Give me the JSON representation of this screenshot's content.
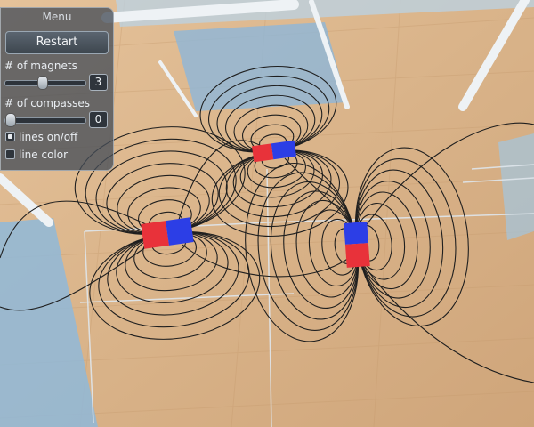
{
  "menu": {
    "title": "Menu",
    "restart_label": "Restart",
    "magnets": {
      "label": "# of magnets",
      "value": "3",
      "fraction": 0.45
    },
    "compasses": {
      "label": "# of compasses",
      "value": "0",
      "fraction": 0.0
    },
    "lines_toggle": {
      "label": "lines on/off",
      "checked": true
    },
    "color_toggle": {
      "label": "line color",
      "checked": false
    }
  },
  "colors": {
    "floor": "#d9b389",
    "wood_grain": "#c59a6d",
    "glass": "#9fc3de",
    "field_lines": "#1f1f1f",
    "magnet_north": "#e8323a",
    "magnet_south": "#2c3ee6"
  },
  "icons": [
    "magnet",
    "compass"
  ]
}
